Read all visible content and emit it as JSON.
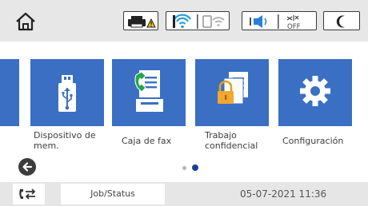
{
  "status_bar": {
    "home_icon": "home-icon",
    "icons": [
      "printer-warning-icon",
      "wifi-icon",
      "wifi-direct-icon",
      "sound-icon",
      "off-icon",
      "night-mode-icon"
    ],
    "colors": {
      "warning": "#f5c400",
      "wifi": "#2a9fd8",
      "sound": "#2a7fd8"
    }
  },
  "apps": [
    {
      "label": "Dispositivo de mem.",
      "icon": "usb-icon"
    },
    {
      "label": "Caja de fax",
      "icon": "fax-box-icon"
    },
    {
      "label": "Trabajo confidencial",
      "icon": "confidential-job-icon"
    },
    {
      "label": "Configuración",
      "icon": "gear-icon"
    }
  ],
  "labels": {
    "app0_line1": "Dispositivo de",
    "app0_line2": "mem.",
    "app1_line1": "Caja de fax",
    "app2_line1": "Trabajo",
    "app2_line2": "confidencial",
    "app3_line1": "Configuración"
  },
  "pagination": {
    "current_page": 2,
    "total_pages": 2
  },
  "bottom_bar": {
    "job_status_label": "Job/Status",
    "datetime": "05-07-2021 11:36"
  },
  "colors": {
    "tile": "#3a6fc4",
    "accent": "#1a3f8f"
  }
}
